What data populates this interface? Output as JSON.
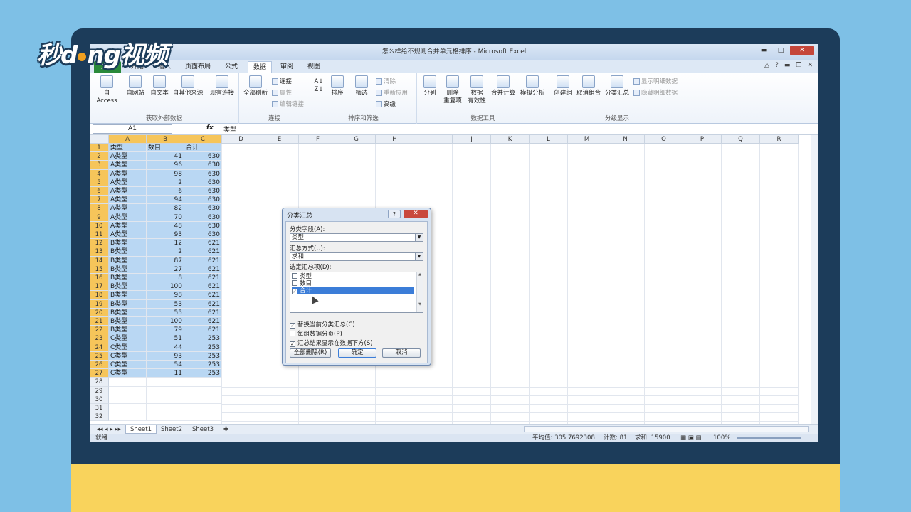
{
  "logo": {
    "text_left": "秒d",
    "text_right": "ng视频"
  },
  "window": {
    "title": "怎么样给不规则合并单元格排序 - Microsoft Excel",
    "min": "▬",
    "max": "□",
    "close": "✕"
  },
  "tabs": [
    "文件",
    "开始",
    "插入",
    "页面布局",
    "公式",
    "数据",
    "审阅",
    "视图"
  ],
  "active_tab": "数据",
  "ribbon": {
    "group1": {
      "label": "获取外部数据",
      "buttons": [
        "自 Access",
        "自网站",
        "自文本",
        "自其他来源",
        "现有连接"
      ]
    },
    "group2": {
      "label": "连接",
      "refresh": "全部刷新",
      "items": [
        "连接",
        "属性",
        "编辑链接"
      ]
    },
    "group3": {
      "label": "排序和筛选",
      "sort": "排序",
      "filter": "筛选",
      "items": [
        "清除",
        "重新应用",
        "高级"
      ]
    },
    "group4": {
      "label": "数据工具",
      "buttons": [
        "分列",
        "删除\n重复项",
        "数据\n有效性",
        "合并计算",
        "模拟分析"
      ]
    },
    "group5": {
      "label": "分级显示",
      "buttons": [
        "创建组",
        "取消组合",
        "分类汇总"
      ],
      "items": [
        "显示明细数据",
        "隐藏明细数据"
      ]
    }
  },
  "formula_bar": {
    "namebox": "A1",
    "fx": "fx",
    "value": "类型"
  },
  "columns": [
    "A",
    "B",
    "C",
    "D",
    "E",
    "F",
    "G",
    "H",
    "I",
    "J",
    "K",
    "L",
    "M",
    "N",
    "O",
    "P",
    "Q",
    "R"
  ],
  "header_row": [
    "类型",
    "数目",
    "合计"
  ],
  "rows": [
    [
      "A类型",
      41,
      630
    ],
    [
      "A类型",
      96,
      630
    ],
    [
      "A类型",
      98,
      630
    ],
    [
      "A类型",
      2,
      630
    ],
    [
      "A类型",
      6,
      630
    ],
    [
      "A类型",
      94,
      630
    ],
    [
      "A类型",
      82,
      630
    ],
    [
      "A类型",
      70,
      630
    ],
    [
      "A类型",
      48,
      630
    ],
    [
      "A类型",
      93,
      630
    ],
    [
      "B类型",
      12,
      621
    ],
    [
      "B类型",
      2,
      621
    ],
    [
      "B类型",
      87,
      621
    ],
    [
      "B类型",
      27,
      621
    ],
    [
      "B类型",
      8,
      621
    ],
    [
      "B类型",
      100,
      621
    ],
    [
      "B类型",
      98,
      621
    ],
    [
      "B类型",
      53,
      621
    ],
    [
      "B类型",
      55,
      621
    ],
    [
      "B类型",
      100,
      621
    ],
    [
      "B类型",
      79,
      621
    ],
    [
      "C类型",
      51,
      253
    ],
    [
      "C类型",
      44,
      253
    ],
    [
      "C类型",
      93,
      253
    ],
    [
      "C类型",
      54,
      253
    ],
    [
      "C类型",
      11,
      253
    ]
  ],
  "extra_rows": [
    28,
    29,
    30,
    31,
    32
  ],
  "sheets": [
    "Sheet1",
    "Sheet2",
    "Sheet3"
  ],
  "status": {
    "ready": "就绪",
    "average": "平均值: 305.7692308",
    "count": "计数: 81",
    "sum": "求和: 15900",
    "zoom": "100%"
  },
  "dialog": {
    "title": "分类汇总",
    "help": "?",
    "close": "✕",
    "field_label": "分类字段(A):",
    "field_value": "类型",
    "method_label": "汇总方式(U):",
    "method_value": "求和",
    "items_label": "选定汇总项(D):",
    "items": [
      {
        "label": "类型",
        "checked": false
      },
      {
        "label": "数目",
        "checked": false
      },
      {
        "label": "合计",
        "checked": true
      }
    ],
    "opt1": "替换当前分类汇总(C)",
    "opt2": "每组数据分页(P)",
    "opt3": "汇总结果显示在数据下方(S)",
    "opt1_checked": true,
    "opt2_checked": false,
    "opt3_checked": true,
    "btn_remove": "全部删除(R)",
    "btn_ok": "确定",
    "btn_cancel": "取消"
  }
}
